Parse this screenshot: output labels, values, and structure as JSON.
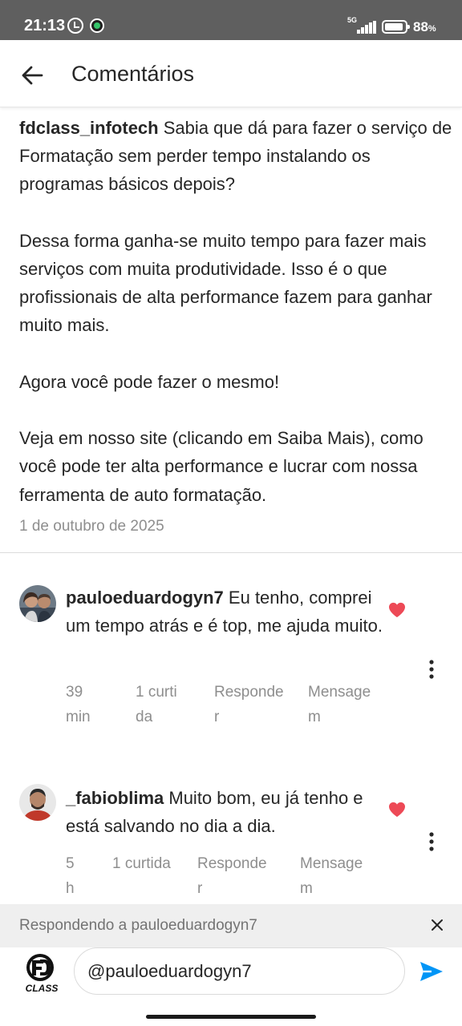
{
  "status_bar": {
    "time": "21:13",
    "network": "5G",
    "battery_value": "88",
    "battery_unit": "%"
  },
  "header": {
    "title": "Comentários",
    "back_icon": "arrow-left-icon"
  },
  "post": {
    "username": "fdclass_infotech",
    "paragraphs": [
      "Sabia que dá para fazer o serviço de Formatação sem perder tempo instalando os programas básicos depois?",
      "Dessa forma ganha-se muito tempo para fazer mais serviços com muita produtividade. Isso é o que profissionais de alta performance fazem para ganhar muito mais.",
      "Agora você pode fazer o mesmo!",
      "Veja em nosso site (clicando em Saiba Mais), como você pode ter alta performance e lucrar com nossa ferramenta de auto formatação."
    ],
    "date": "1 de outubro de 2025"
  },
  "comments": [
    {
      "username": "pauloeduardogyn7",
      "text": "Eu tenho, comprei um tempo atrás e é top, me ajuda muito.",
      "time": "39 min",
      "likes": "1 curtida",
      "reply_label": "Responder",
      "message_label": "Mensagem",
      "liked": true
    },
    {
      "username": "_fabioblima",
      "text": "Muito bom, eu já tenho e está salvando no dia a dia.",
      "time": "5 h",
      "likes": "1 curtida",
      "reply_label": "Responder",
      "message_label": "Mensagem",
      "liked": true
    }
  ],
  "reply_bar": {
    "text": "Respondendo a pauloeduardogyn7"
  },
  "composer": {
    "value": "@pauloeduardogyn7",
    "logo_text": "CLASS"
  },
  "colors": {
    "heart": "#ed4956",
    "send": "#0095f6",
    "meta": "#8e8e8e",
    "status_bar": "#5f5f5f"
  }
}
